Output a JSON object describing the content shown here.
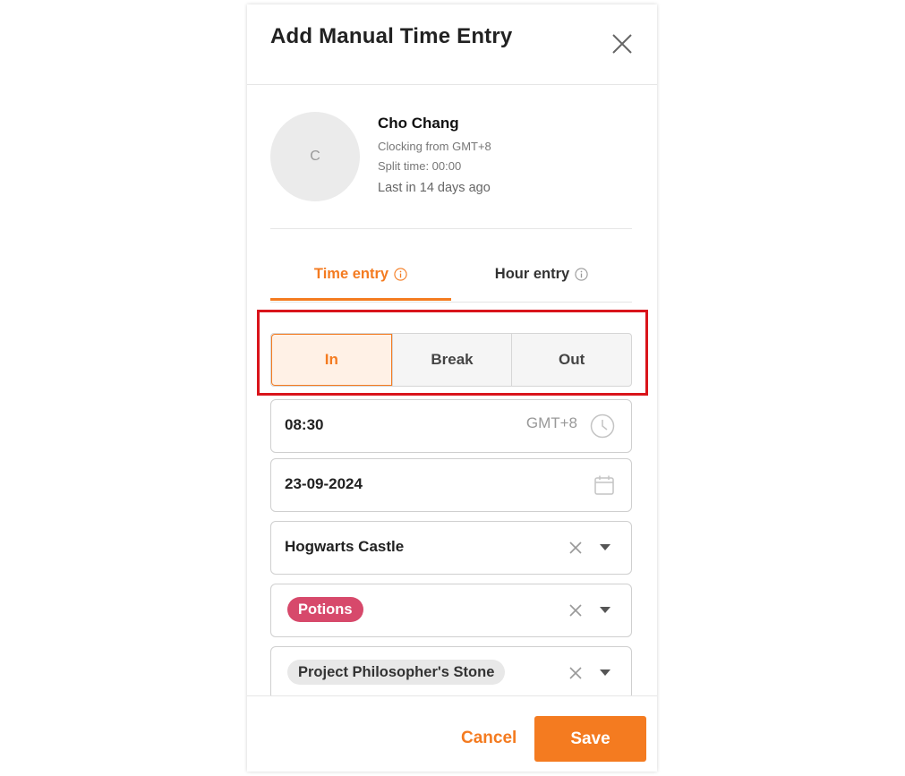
{
  "dialog": {
    "title": "Add Manual Time Entry"
  },
  "user": {
    "initial": "C",
    "name": "Cho Chang",
    "clocking_from": "Clocking from GMT+8",
    "split_time": "Split time: 00:00",
    "last_in": "Last in 14 days ago"
  },
  "tabs": [
    {
      "label": "Time entry",
      "active": true
    },
    {
      "label": "Hour entry",
      "active": false
    }
  ],
  "segment": {
    "options": [
      "In",
      "Break",
      "Out"
    ],
    "selected": "In"
  },
  "time_field": {
    "value": "08:30",
    "timezone": "GMT+8",
    "icon": "clock-icon"
  },
  "date_field": {
    "value": "23-09-2024",
    "icon": "calendar-icon"
  },
  "location_field": {
    "value": "Hogwarts Castle"
  },
  "department_field": {
    "value": "Potions",
    "chip_color": "#d7496b"
  },
  "project_field": {
    "value": "Project Philosopher's Stone",
    "chip_color": "#e8e8e8"
  },
  "footer": {
    "cancel_label": "Cancel",
    "save_label": "Save"
  },
  "colors": {
    "accent": "#f47b20",
    "highlight_box": "#d9141b"
  }
}
